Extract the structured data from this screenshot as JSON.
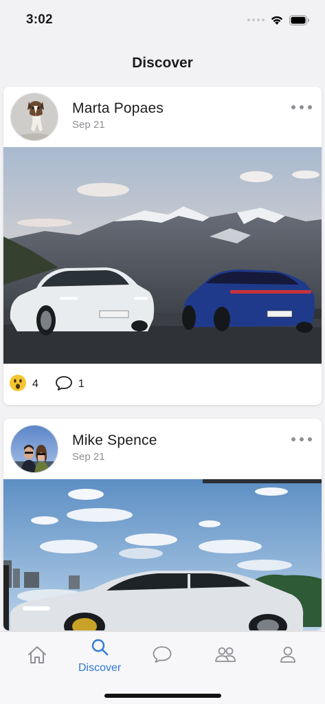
{
  "status_bar": {
    "time": "3:02"
  },
  "header": {
    "title": "Discover"
  },
  "posts": [
    {
      "author": "Marta Popaes",
      "date": "Sep 21",
      "reactions": {
        "emoji": "😮",
        "count": "4"
      },
      "comments": {
        "count": "1"
      }
    },
    {
      "author": "Mike Spence",
      "date": "Sep 21"
    }
  ],
  "tab_bar": {
    "active_tab": "Discover",
    "tabs": [
      {
        "icon": "home-icon"
      },
      {
        "icon": "search-icon",
        "label": "Discover"
      },
      {
        "icon": "chat-icon"
      },
      {
        "icon": "friends-icon"
      },
      {
        "icon": "profile-icon"
      }
    ]
  },
  "colors": {
    "accent": "#2f79d8",
    "background": "#f2f2f4",
    "card": "#ffffff",
    "secondary_text": "#8e8e93"
  }
}
